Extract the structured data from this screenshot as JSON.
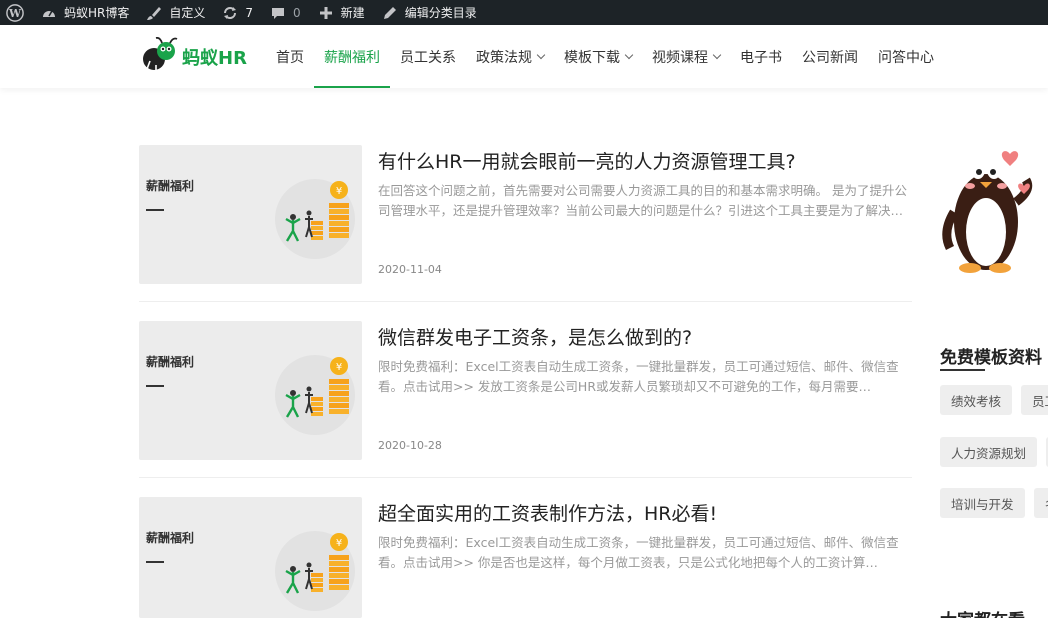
{
  "adminbar": {
    "site_name": "蚂蚁HR博客",
    "customize": "自定义",
    "updates_count": "7",
    "comments_count": "0",
    "new_label": "新建",
    "edit_label": "编辑分类目录"
  },
  "header": {
    "logo_text": "蚂蚁HR",
    "nav": [
      {
        "label": "首页"
      },
      {
        "label": "薪酬福利"
      },
      {
        "label": "员工关系"
      },
      {
        "label": "政策法规"
      },
      {
        "label": "模板下载"
      },
      {
        "label": "视频课程"
      },
      {
        "label": "电子书"
      },
      {
        "label": "公司新闻"
      },
      {
        "label": "问答中心"
      }
    ]
  },
  "posts": [
    {
      "thumb_category": "薪酬福利",
      "title": "有什么HR一用就会眼前一亮的人力资源管理工具?",
      "excerpt": "在回答这个问题之前，首先需要对公司需要人力资源工具的目的和基本需求明确。 是为了提升公司管理水平，还是提升管理效率？当前公司最大的问题是什么？引进这个工具主要是为了解决…",
      "date": "2020-11-04"
    },
    {
      "thumb_category": "薪酬福利",
      "title": "微信群发电子工资条，是怎么做到的?",
      "excerpt": "限时免费福利：Excel工资表自动生成工资条，一键批量群发，员工可通过短信、邮件、微信查看。点击试用>> 发放工资条是公司HR或发薪人员繁琐却又不可避免的工作，每月需要…",
      "date": "2020-10-28"
    },
    {
      "thumb_category": "薪酬福利",
      "title": "超全面实用的工资表制作方法，HR必看!",
      "excerpt": "限时免费福利：Excel工资表自动生成工资条，一键批量群发，员工可通过短信、邮件、微信查看。点击试用>> 你是否也是这样，每个月做工资表，只是公式化地把每个人的工资计算…",
      "date": ""
    }
  ],
  "sidebar": {
    "free_templates_title": "免费模板资料",
    "tags": [
      "绩效考核",
      "员工",
      "人力资源规划",
      "",
      "培训与开发",
      "名"
    ],
    "everyone_watching_title": "大家都在看"
  },
  "colors": {
    "brand_green": "#1aa34a",
    "adminbar_bg": "#1d2327"
  }
}
